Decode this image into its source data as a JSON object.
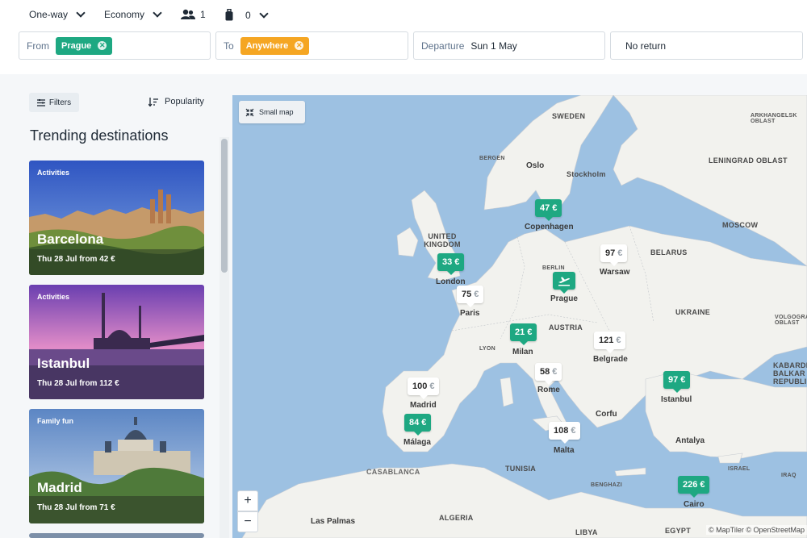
{
  "topbar": {
    "trip_type": "One-way",
    "cabin": "Economy",
    "passengers": "1",
    "bags": "0"
  },
  "search": {
    "from_label": "From",
    "from_value": "Prague",
    "to_label": "To",
    "to_value": "Anywhere",
    "departure_label": "Departure",
    "departure_value": "Sun 1 May",
    "return_value": "No return"
  },
  "sidebar": {
    "filters_label": "Filters",
    "sort_label": "Popularity",
    "heading": "Trending destinations",
    "cards": [
      {
        "tag": "Activities",
        "city": "Barcelona",
        "price": "Thu 28 Jul from 42 €"
      },
      {
        "tag": "Activities",
        "city": "Istanbul",
        "price": "Thu 28 Jul from 112 €"
      },
      {
        "tag": "Family fun",
        "city": "Madrid",
        "price": "Thu 28 Jul from 71 €"
      }
    ]
  },
  "map": {
    "small_map_label": "Small map",
    "zoom_in": "+",
    "zoom_out": "−",
    "attribution": "© MapTiler © OpenStreetMap",
    "countries": [
      "SWEDEN",
      "UNITED KINGDOM",
      "BELARUS",
      "UKRAINE",
      "AUSTRIA",
      "MOSCOW",
      "LENINGRAD OBLAST",
      "ARKHANGELSK OBLAST",
      "VOLGOGRAD OBLAST",
      "KABARDINO BALKAR REPUBLIC",
      "TUNISIA",
      "ALGERIA",
      "EGYPT",
      "LIBYA",
      "ISRAEL",
      "IRAQ",
      "CASABLANCA",
      "BENGHAZI",
      "BERGEN",
      "LYON",
      "BERLIN"
    ],
    "cities": [
      "Oslo",
      "Stockholm",
      "Copenhagen",
      "London",
      "Paris",
      "Warsaw",
      "Prague",
      "Milan",
      "Belgrade",
      "Rome",
      "Madrid",
      "Málaga",
      "Malta",
      "Corfu",
      "Istanbul",
      "Antalya",
      "Cairo",
      "Las Palmas"
    ],
    "prices": [
      {
        "label": "47",
        "currency": "€",
        "style": "green"
      },
      {
        "label": "33",
        "currency": "€",
        "style": "green"
      },
      {
        "label": "75",
        "currency": "€",
        "style": "white"
      },
      {
        "label": "97",
        "currency": "€",
        "style": "white"
      },
      {
        "label": "21",
        "currency": "€",
        "style": "green"
      },
      {
        "label": "121",
        "currency": "€",
        "style": "white"
      },
      {
        "label": "58",
        "currency": "€",
        "style": "white"
      },
      {
        "label": "100",
        "currency": "€",
        "style": "white"
      },
      {
        "label": "84",
        "currency": "€",
        "style": "green"
      },
      {
        "label": "108",
        "currency": "€",
        "style": "white"
      },
      {
        "label": "97",
        "currency": "€",
        "style": "green"
      },
      {
        "label": "226",
        "currency": "€",
        "style": "green"
      }
    ]
  },
  "colors": {
    "accent_green": "#1ea882",
    "accent_orange": "#f5a623",
    "sea": "#9dc1e2",
    "land": "#f2f2ee"
  }
}
